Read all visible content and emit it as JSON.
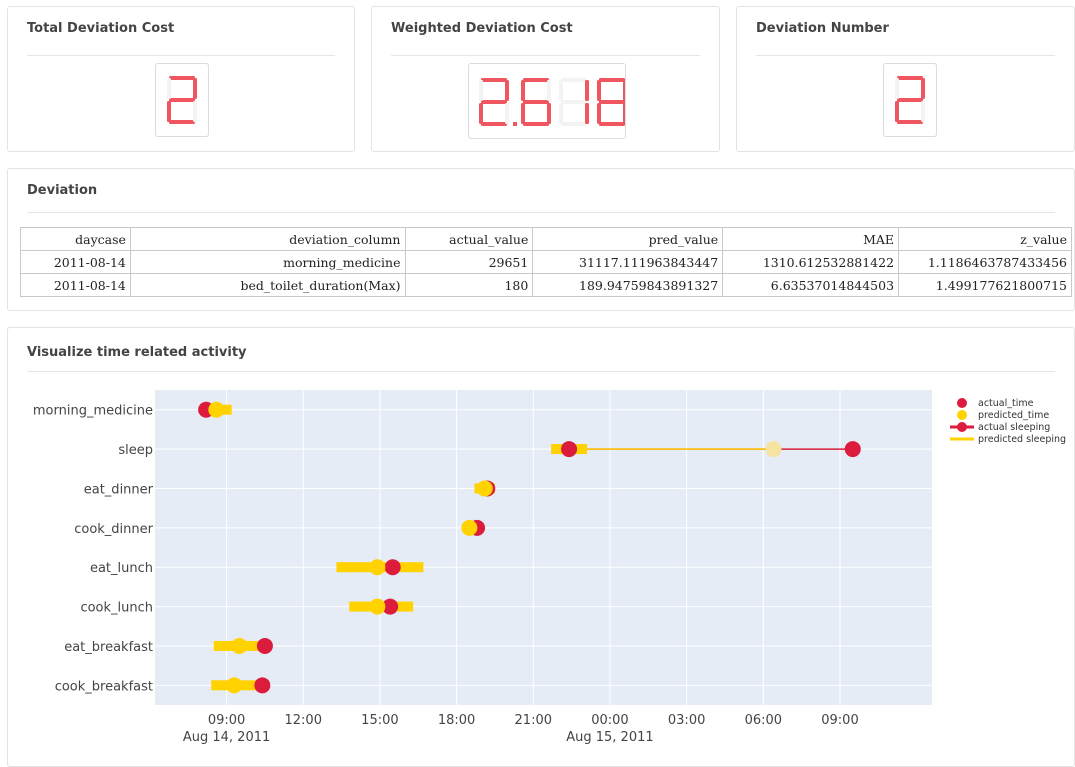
{
  "kpis": [
    {
      "title": "Total Deviation Cost",
      "value": "2"
    },
    {
      "title": "Weighted Deviation Cost",
      "value": "2.618"
    },
    {
      "title": "Deviation Number",
      "value": "2"
    }
  ],
  "deviation": {
    "title": "Deviation",
    "columns": [
      "daycase",
      "deviation_column",
      "actual_value",
      "pred_value",
      "MAE",
      "z_value"
    ],
    "rows": [
      [
        "2011-08-14",
        "morning_medicine",
        "29651",
        "31117.111963843447",
        "1310.612532881422",
        "1.1186463787433456"
      ],
      [
        "2011-08-14",
        "bed_toilet_duration(Max)",
        "180",
        "189.94759843891327",
        "6.63537014844503",
        "1.499177621800715"
      ]
    ]
  },
  "activity_chart": {
    "title": "Visualize time related activity"
  },
  "chart_data": {
    "type": "scatter",
    "y_categories": [
      "morning_medicine",
      "sleep",
      "eat_dinner",
      "cook_dinner",
      "eat_lunch",
      "cook_lunch",
      "eat_breakfast",
      "cook_breakfast"
    ],
    "x_tick_labels": [
      "09:00",
      "12:00",
      "15:00",
      "18:00",
      "21:00",
      "00:00",
      "03:00",
      "06:00",
      "09:00"
    ],
    "x_tick_hours": [
      33,
      36,
      39,
      42,
      45,
      48,
      51,
      54,
      57
    ],
    "x_date_labels": [
      {
        "hour": 33,
        "text": "Aug 14, 2011"
      },
      {
        "hour": 48,
        "text": "Aug 15, 2011"
      }
    ],
    "x_range_hours": [
      30.2,
      60.6
    ],
    "x_hour_origin_date": "2011-08-13",
    "series": [
      {
        "name": "actual_time",
        "color": "#dc1c3c",
        "points": [
          {
            "y": "morning_medicine",
            "x": 32.2
          },
          {
            "y": "eat_dinner",
            "x": 43.2
          },
          {
            "y": "cook_dinner",
            "x": 42.8
          },
          {
            "y": "eat_lunch",
            "x": 39.5
          },
          {
            "y": "cook_lunch",
            "x": 39.4
          },
          {
            "y": "eat_breakfast",
            "x": 34.5
          },
          {
            "y": "cook_breakfast",
            "x": 34.4
          }
        ]
      },
      {
        "name": "predicted_time",
        "color": "#ffd200",
        "points": [
          {
            "y": "morning_medicine",
            "x": 32.6,
            "low": 32.0,
            "high": 33.2
          },
          {
            "y": "eat_dinner",
            "x": 43.1,
            "low": 42.7,
            "high": 43.5
          },
          {
            "y": "cook_dinner",
            "x": 42.5,
            "low": 42.3,
            "high": 42.7
          },
          {
            "y": "eat_lunch",
            "x": 38.9,
            "low": 37.3,
            "high": 40.7
          },
          {
            "y": "cook_lunch",
            "x": 38.9,
            "low": 37.8,
            "high": 40.3
          },
          {
            "y": "eat_breakfast",
            "x": 33.5,
            "low": 32.5,
            "high": 34.5
          },
          {
            "y": "cook_breakfast",
            "x": 33.3,
            "low": 32.4,
            "high": 34.3
          }
        ]
      },
      {
        "name": "actual sleeping",
        "color": "#dc1c3c",
        "start": 46.4,
        "end": 57.5
      },
      {
        "name": "predicted sleeping",
        "color": "#ffd200",
        "start": 46.4,
        "end": 54.4,
        "start_low": 45.7,
        "start_high": 47.1
      }
    ]
  }
}
